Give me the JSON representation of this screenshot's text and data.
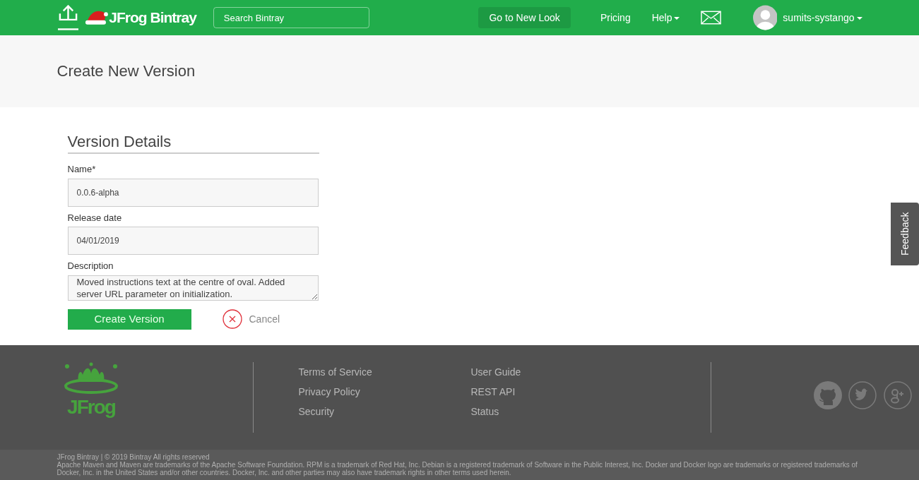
{
  "navbar": {
    "brand": "JFrog Bintray",
    "search": {
      "placeholder": "Search Bintray"
    },
    "new_look_button": "Go to New Look",
    "menu": [
      {
        "label": "Pricing",
        "dropdown": false
      },
      {
        "label": "Help",
        "dropdown": true
      }
    ],
    "user": {
      "name": "sumits-systango",
      "dropdown": true
    }
  },
  "page_title": "Create New Version",
  "form": {
    "section_title": "Version Details",
    "fields": [
      {
        "kind": "input",
        "label": "Name*",
        "value": "0.0.6-alpha"
      },
      {
        "kind": "input",
        "label": "Release date",
        "value": "04/01/2019"
      },
      {
        "kind": "textarea",
        "label": "Description",
        "value": "Moved instructions text at the centre of oval. Added server URL parameter on initialization."
      }
    ],
    "submit": "Create Version",
    "cancel": "Cancel"
  },
  "feedback_tab": "Feedback",
  "footer": {
    "logo_text": "JFrog",
    "link_columns": [
      [
        "Terms of Service",
        "Privacy Policy",
        "Security"
      ],
      [
        "User Guide",
        "REST API",
        "Status"
      ]
    ],
    "copyright": "JFrog Bintray | © 2019 Bintray All rights reserved",
    "trademarks": "Apache Maven and Maven are trademarks of the Apache Software Foundation. RPM is a trademark of Red Hat, Inc. Debian is a registered trademark of Software in the Public Interest, Inc. Docker and Docker logo are trademarks or registered trademarks of Docker, Inc. in the United States and/or other countries. Docker, Inc. and other parties may also have trademark rights in other terms used herein."
  }
}
